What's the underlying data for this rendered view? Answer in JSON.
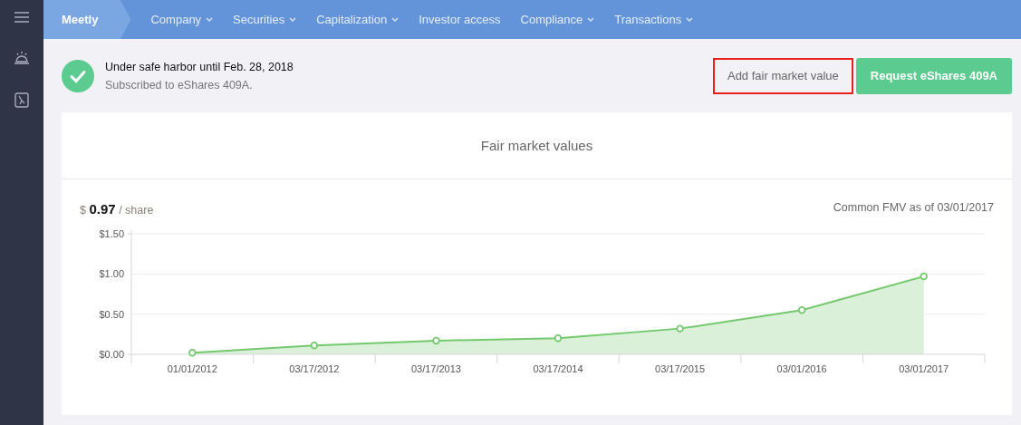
{
  "nav": {
    "brand": "Meetly",
    "items": [
      {
        "label": "Company",
        "dropdown": true
      },
      {
        "label": "Securities",
        "dropdown": true
      },
      {
        "label": "Capitalization",
        "dropdown": true
      },
      {
        "label": "Investor access",
        "dropdown": false
      },
      {
        "label": "Compliance",
        "dropdown": true
      },
      {
        "label": "Transactions",
        "dropdown": true
      }
    ]
  },
  "status": {
    "title": "Under safe harbor until Feb. 28, 2018",
    "subtitle": "Subscribed to eShares 409A."
  },
  "buttons": [
    {
      "label": "Add fair market value",
      "kind": "secondary",
      "highlighted": true
    },
    {
      "label": "Request eShares 409A",
      "kind": "primary",
      "highlighted": false
    }
  ],
  "card": {
    "title": "Fair market values",
    "currency": "$",
    "price": "0.97",
    "unit": "/ share",
    "as_of": "Common FMV as of 03/01/2017",
    "chart_data": {
      "type": "area",
      "categories": [
        "01/01/2012",
        "03/17/2012",
        "03/17/2013",
        "03/17/2014",
        "03/17/2015",
        "03/01/2016",
        "03/01/2017"
      ],
      "series": [
        {
          "color": "#74c96e",
          "values": [
            0.02,
            0.11,
            0.17,
            0.2,
            0.32,
            0.55,
            0.97
          ]
        }
      ],
      "ylim": [
        0,
        1.5
      ],
      "yticks": [
        {
          "value": 0,
          "label": "$0.00"
        },
        {
          "value": 0.5,
          "label": "$0.50"
        },
        {
          "value": 1,
          "label": "$1.00"
        },
        {
          "value": 1.5,
          "label": "$1.50"
        }
      ]
    }
  }
}
